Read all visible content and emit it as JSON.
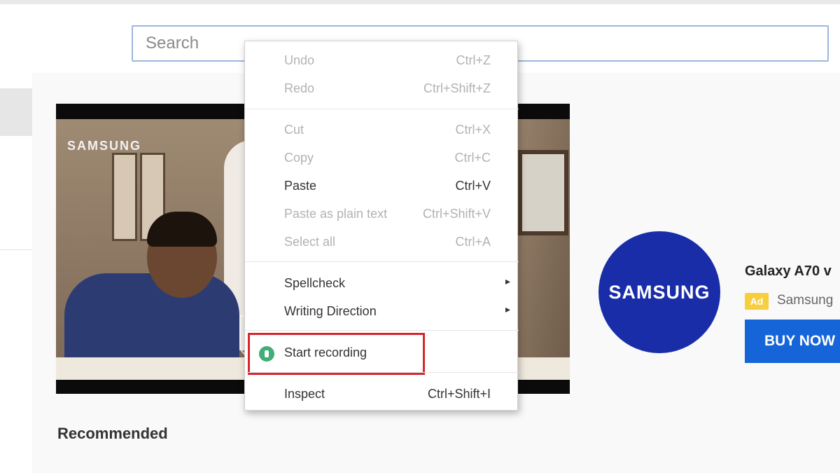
{
  "search": {
    "placeholder": "Search"
  },
  "video": {
    "brand_label": "SAMSUNG"
  },
  "ad": {
    "logo_text": "SAMSUNG",
    "title": "Galaxy A70 v",
    "badge": "Ad",
    "source": "Samsung",
    "button_label": "BUY NOW"
  },
  "section": {
    "title": "Recommended"
  },
  "context_menu": {
    "items": [
      {
        "label": "Undo",
        "shortcut": "Ctrl+Z"
      },
      {
        "label": "Redo",
        "shortcut": "Ctrl+Shift+Z"
      },
      {
        "label": "Cut",
        "shortcut": "Ctrl+X"
      },
      {
        "label": "Copy",
        "shortcut": "Ctrl+C"
      },
      {
        "label": "Paste",
        "shortcut": "Ctrl+V"
      },
      {
        "label": "Paste as plain text",
        "shortcut": "Ctrl+Shift+V"
      },
      {
        "label": "Select all",
        "shortcut": "Ctrl+A"
      },
      {
        "label": "Spellcheck",
        "submenu_arrow": "▸"
      },
      {
        "label": "Writing Direction",
        "submenu_arrow": "▸"
      },
      {
        "label": "Start recording",
        "icon": "screen-recorder-icon"
      },
      {
        "label": "Inspect",
        "shortcut": "Ctrl+Shift+I"
      }
    ]
  },
  "colors": {
    "highlight": "#d8262e",
    "brand_blue": "#1a2da8",
    "button_blue": "#1565d8",
    "ad_badge": "#f7cf3d",
    "recorder_icon": "#3fae78"
  }
}
